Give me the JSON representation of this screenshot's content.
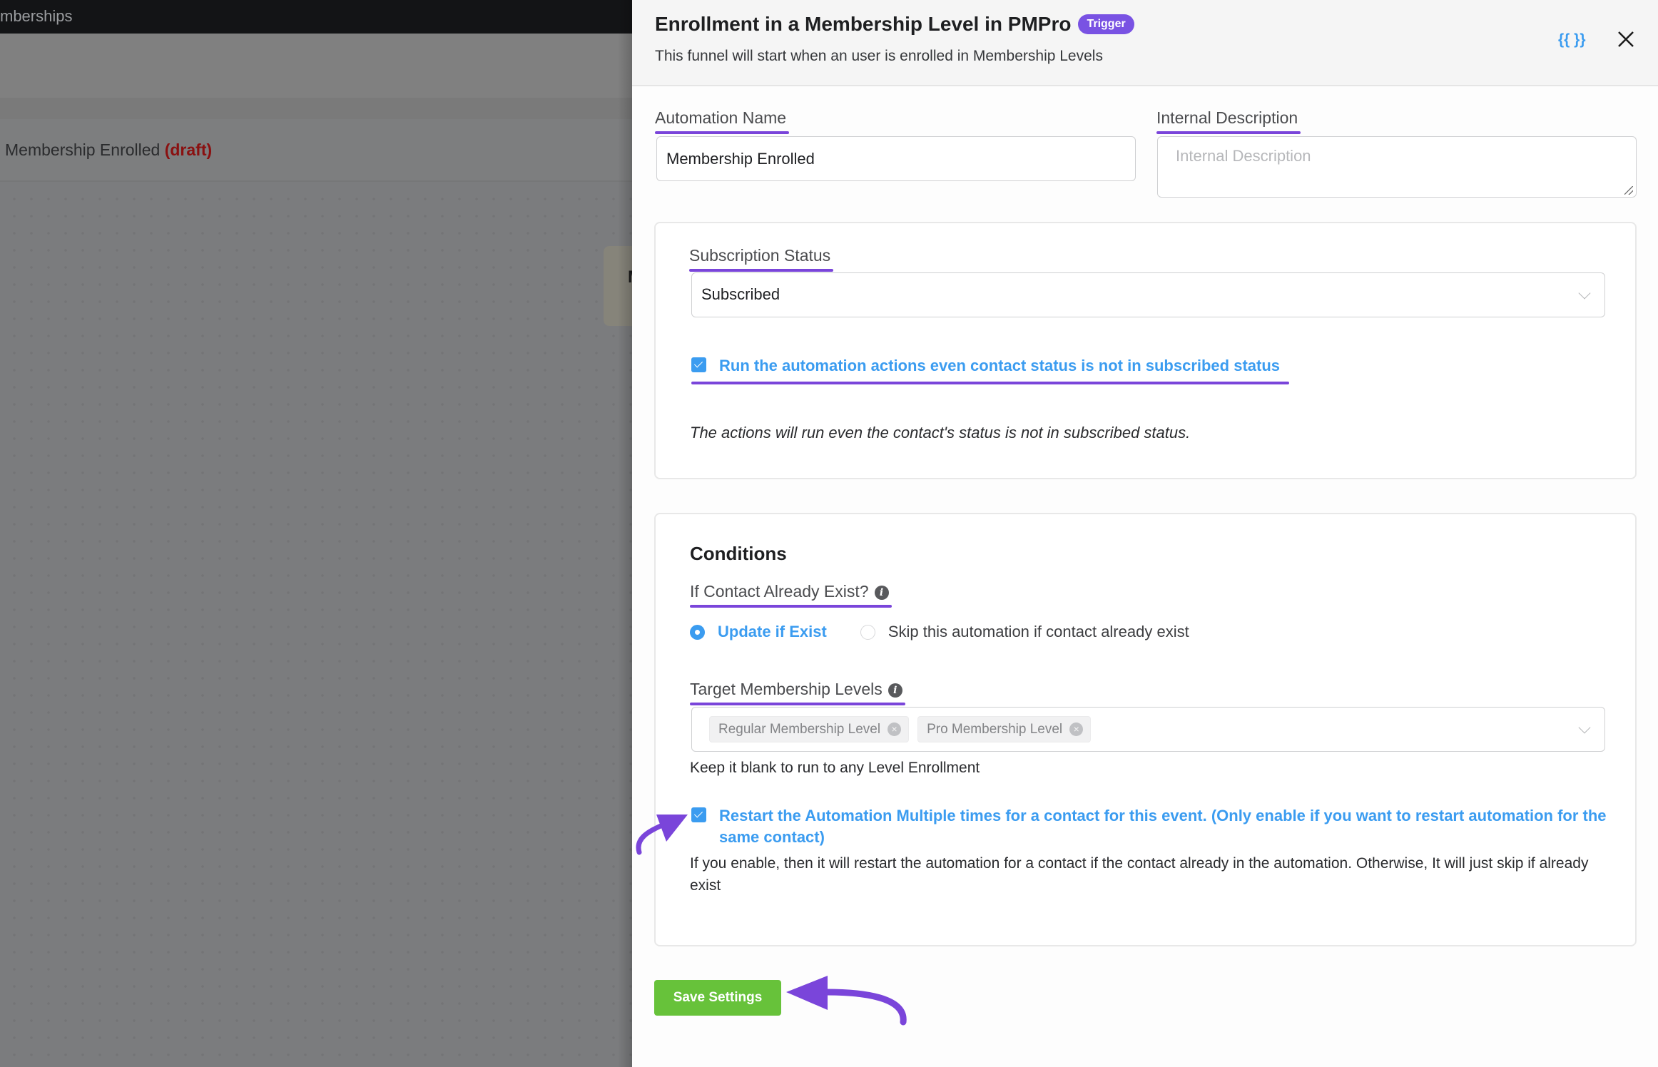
{
  "background": {
    "breadcrumb": "mberships",
    "automation_name": "Membership Enrolled",
    "automation_status": "(draft)",
    "node_partial_text": "M"
  },
  "drawer": {
    "title": "Enrollment in a Membership Level in PMPro",
    "badge": "Trigger",
    "subtitle": "This funnel will start when an user is enrolled in Membership Levels",
    "shortcode_icon": "{{ }}",
    "close_icon": "close-icon"
  },
  "form": {
    "automation_name_label": "Automation Name",
    "automation_name_value": "Membership Enrolled",
    "internal_description_label": "Internal Description",
    "internal_description_placeholder": "Internal Description",
    "internal_description_value": ""
  },
  "subscription": {
    "label": "Subscription Status",
    "selected": "Subscribed",
    "run_anyway_checked": true,
    "run_anyway_label": "Run the automation actions even contact status is not in subscribed status",
    "note": "The actions will run even the contact's status is not in subscribed status."
  },
  "conditions": {
    "heading": "Conditions",
    "if_exists_label": "If Contact Already Exist?",
    "options": [
      {
        "label": "Update if Exist",
        "selected": true
      },
      {
        "label": "Skip this automation if contact already exist",
        "selected": false
      }
    ],
    "target_levels_label": "Target Membership Levels",
    "target_levels": [
      "Regular Membership Level",
      "Pro Membership Level"
    ],
    "target_levels_help": "Keep it blank to run to any Level Enrollment",
    "restart_checked": true,
    "restart_label": "Restart the Automation Multiple times for a contact for this event. (Only enable if you want to restart automation for the same contact)",
    "restart_help": "If you enable, then it will restart the automation for a contact if the contact already in the automation. Otherwise, It will just skip if already exist"
  },
  "actions": {
    "save_label": "Save Settings"
  },
  "colors": {
    "accent_purple": "#7952e3",
    "annotation_purple": "#7a45da",
    "link_blue": "#3b9cf0",
    "save_green": "#67c23a",
    "draft_red": "#8a1010"
  }
}
